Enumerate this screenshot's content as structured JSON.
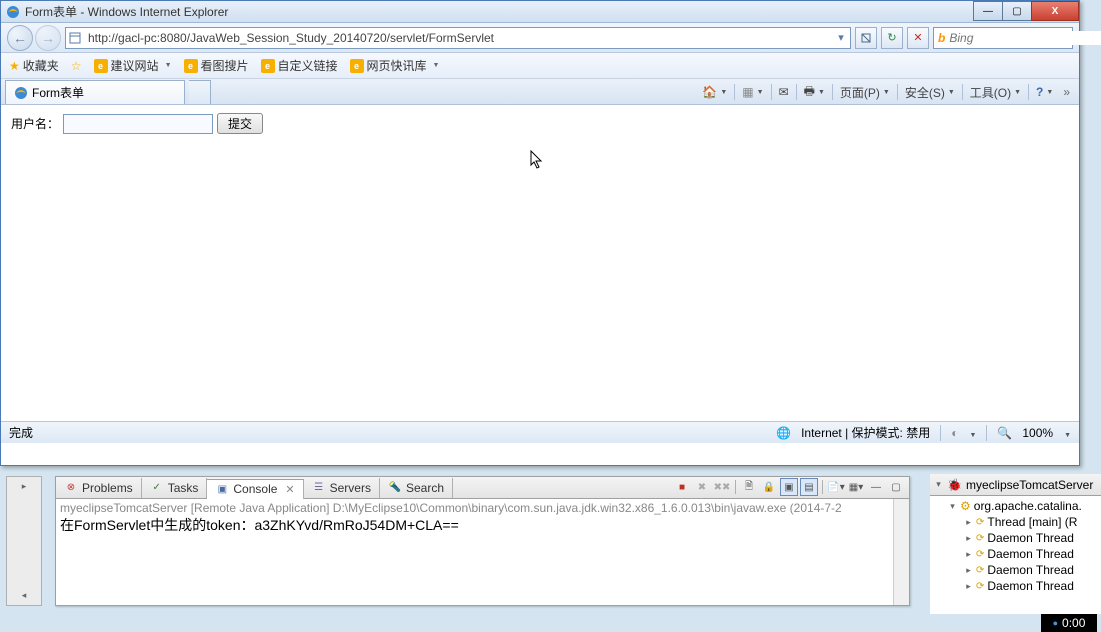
{
  "window": {
    "title": "Form表单 - Windows Internet Explorer",
    "min": "—",
    "max": "▢",
    "close": "X"
  },
  "nav": {
    "url": "http://gacl-pc:8080/JavaWeb_Session_Study_20140720/servlet/FormServlet",
    "search_placeholder": "Bing",
    "refresh": "↻",
    "stop": "✕",
    "dropdown": "▾"
  },
  "favbar": {
    "favorites": "收藏夹",
    "suggest": "建议网站",
    "image_search": "看图搜片",
    "custom_links": "自定义链接",
    "web_snippets": "网页快讯库"
  },
  "tab": {
    "title": "Form表单"
  },
  "cmdbar": {
    "page": "页面(P)",
    "safety": "安全(S)",
    "tools": "工具(O)"
  },
  "form": {
    "label": "用户名：",
    "submit": "提交"
  },
  "status": {
    "done": "完成",
    "zone": "Internet | 保护模式: 禁用",
    "zoom": "100%"
  },
  "eclipse": {
    "tabs": {
      "problems": "Problems",
      "tasks": "Tasks",
      "console": "Console",
      "servers": "Servers",
      "search": "Search"
    },
    "launch_line": "myeclipseTomcatServer [Remote Java Application] D:\\MyEclipse10\\Common\\binary\\com.sun.java.jdk.win32.x86_1.6.0.013\\bin\\javaw.exe (2014-7-2",
    "output_line": "在FormServlet中生成的token：a3ZhKYvd/RmRoJ54DM+CLA=="
  },
  "tree": {
    "root": "myeclipseTomcatServer",
    "child1": "org.apache.catalina.",
    "thread_main": "Thread [main] (R",
    "daemon": "Daemon Thread"
  },
  "clock": "0:00"
}
